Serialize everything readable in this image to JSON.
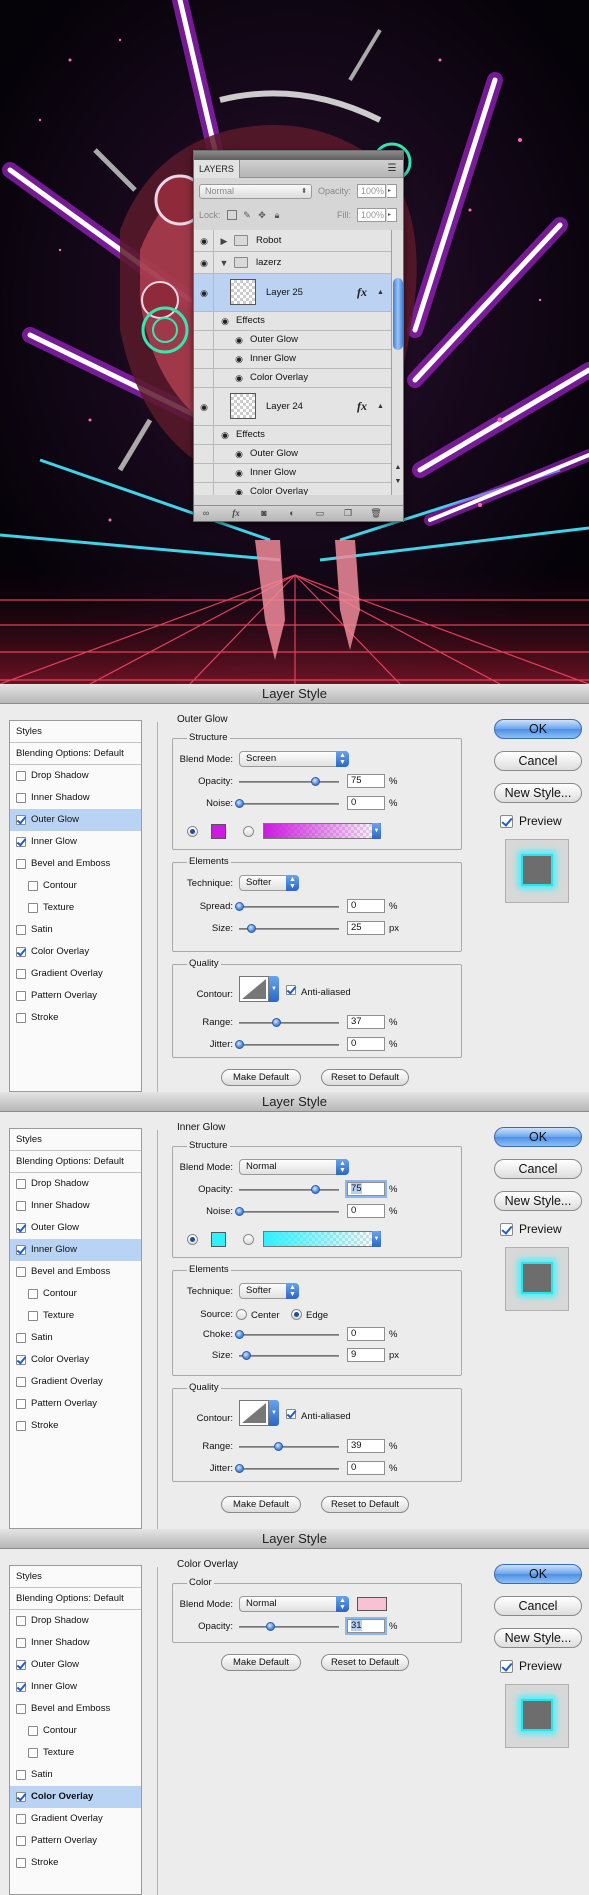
{
  "layers_panel": {
    "tab": "LAYERS",
    "blend_mode": "Normal",
    "opacity_label": "Opacity:",
    "opacity_value": "100%",
    "lock_label": "Lock:",
    "fill_label": "Fill:",
    "fill_value": "100%",
    "rows": [
      {
        "name": "Robot",
        "type": "group",
        "expanded": false
      },
      {
        "name": "lazerz",
        "type": "group",
        "expanded": true
      },
      {
        "name": "Layer 25",
        "type": "layer",
        "selected": true
      },
      {
        "name": "Effects",
        "type": "effects"
      },
      {
        "name": "Outer Glow",
        "type": "effect"
      },
      {
        "name": "Inner Glow",
        "type": "effect"
      },
      {
        "name": "Color Overlay",
        "type": "effect"
      },
      {
        "name": "Layer 24",
        "type": "layer",
        "selected": false
      },
      {
        "name": "Effects",
        "type": "effects"
      },
      {
        "name": "Outer Glow",
        "type": "effect"
      },
      {
        "name": "Inner Glow",
        "type": "effect"
      },
      {
        "name": "Color Overlay",
        "type": "effect"
      }
    ]
  },
  "styles_list": {
    "heading": "Styles",
    "blending": "Blending Options: Default",
    "items": [
      "Drop Shadow",
      "Inner Shadow",
      "Outer Glow",
      "Inner Glow",
      "Bevel and Emboss",
      "Contour",
      "Texture",
      "Satin",
      "Color Overlay",
      "Gradient Overlay",
      "Pattern Overlay",
      "Stroke"
    ]
  },
  "buttons": {
    "ok": "OK",
    "cancel": "Cancel",
    "new_style": "New Style...",
    "preview": "Preview",
    "make_default": "Make Default",
    "reset_default": "Reset to Default"
  },
  "labels": {
    "structure": "Structure",
    "elements": "Elements",
    "quality": "Quality",
    "color": "Color",
    "blend_mode": "Blend Mode:",
    "opacity": "Opacity:",
    "noise": "Noise:",
    "technique": "Technique:",
    "spread": "Spread:",
    "size": "Size:",
    "source": "Source:",
    "center": "Center",
    "edge": "Edge",
    "choke": "Choke:",
    "contour": "Contour:",
    "anti_aliased": "Anti-aliased",
    "range": "Range:",
    "jitter": "Jitter:",
    "percent": "%",
    "px": "px"
  },
  "dialogs": [
    {
      "window_title": "Layer Style",
      "section": "Outer Glow",
      "checked": [
        "Outer Glow",
        "Inner Glow",
        "Color Overlay"
      ],
      "selected": "Outer Glow",
      "blend_mode": "Screen",
      "opacity": "75",
      "noise": "0",
      "glow_color": "#cc1adf",
      "technique": "Softer",
      "spread": "0",
      "size": "25",
      "range": "37",
      "jitter": "0"
    },
    {
      "window_title": "Layer Style",
      "section": "Inner Glow",
      "checked": [
        "Outer Glow",
        "Inner Glow",
        "Color Overlay"
      ],
      "selected": "Inner Glow",
      "blend_mode": "Normal",
      "opacity": "75",
      "noise": "0",
      "glow_color": "#2ff0ff",
      "technique": "Softer",
      "source": "Edge",
      "choke": "0",
      "size": "9",
      "range": "39",
      "jitter": "0"
    },
    {
      "window_title": "Layer Style",
      "section": "Color Overlay",
      "checked": [
        "Outer Glow",
        "Inner Glow",
        "Color Overlay"
      ],
      "selected": "Color Overlay",
      "blend_mode": "Normal",
      "overlay_color": "#f7c3d4",
      "opacity": "31"
    }
  ]
}
